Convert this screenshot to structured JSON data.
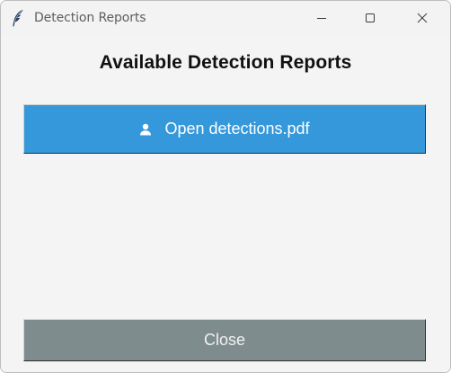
{
  "window": {
    "title": "Detection Reports",
    "icon": "feather-icon",
    "controls": {
      "minimize": "minimize-icon",
      "maximize": "maximize-icon",
      "close": "close-icon"
    }
  },
  "main": {
    "heading": "Available Detection Reports",
    "report_buttons": [
      {
        "label": "Open detections.pdf",
        "icon": "user-icon"
      }
    ],
    "close_label": "Close"
  },
  "colors": {
    "open_button": "#3498db",
    "close_button": "#7f8c8d",
    "background": "#f4f4f4"
  }
}
